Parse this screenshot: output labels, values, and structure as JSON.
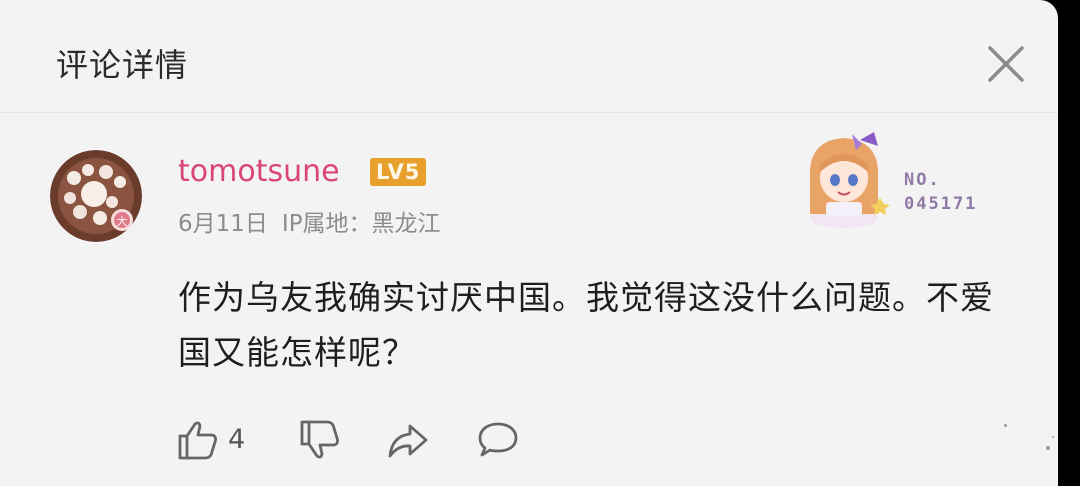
{
  "header": {
    "title": "评论详情"
  },
  "comment": {
    "username": "tomotsune",
    "level_badge": "LV5",
    "date": "6月11日",
    "ip_location": "IP属地：黑龙江",
    "text": "作为乌友我确实讨厌中国。我觉得这没什么问题。不爱国又能怎样呢？",
    "fan_card": {
      "number_label": "NO.",
      "number_value": "045171"
    },
    "likes": "4"
  },
  "colors": {
    "username": "#d9457a",
    "level_badge": "#e7a02b",
    "meta_text": "#8c8c8c",
    "icon_stroke": "#666666"
  },
  "icons": [
    "close-icon",
    "thumbs-up-icon",
    "thumbs-down-icon",
    "share-icon",
    "comment-bubble-icon"
  ]
}
